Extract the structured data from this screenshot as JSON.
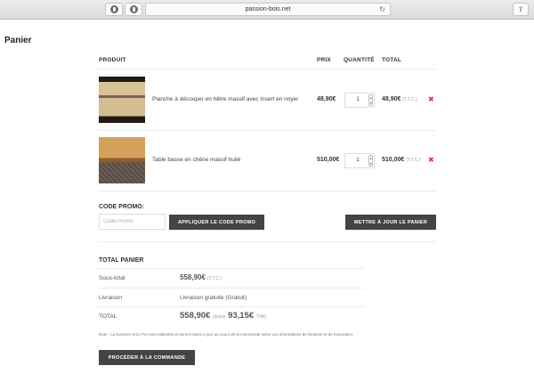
{
  "browser": {
    "address": "passion-bois.net",
    "reload_glyph": "↻",
    "share_glyph": "⇪"
  },
  "page": {
    "title": "Panier"
  },
  "table": {
    "headers": {
      "product": "PRODUIT",
      "price": "PRIX",
      "quantity": "QUANTITÉ",
      "total": "TOTAL"
    },
    "rows": [
      {
        "name": "Planche à découper en hêtre massif avec insert en noyer",
        "price": "48,90€",
        "quantity": "1",
        "total": "48,90€",
        "total_suffix": "(T.T.C.)",
        "remove": "✖"
      },
      {
        "name": "Table basse en chêne massif huilé",
        "price": "510,00€",
        "quantity": "1",
        "total": "510,00€",
        "total_suffix": "(T.T.C.)",
        "remove": "✖"
      }
    ]
  },
  "promo": {
    "label": "CODE PROMO:",
    "placeholder": "Code Promo",
    "apply_label": "APPLIQUER LE CODE PROMO",
    "update_label": "METTRE À JOUR LE PANIER"
  },
  "totals": {
    "title": "TOTAL PANIER",
    "subtotal_label": "Sous-total",
    "subtotal_value": "558,90€",
    "subtotal_suffix": "(T.T.C.)",
    "shipping_label": "Livraison",
    "shipping_value": "Livraison gratuite (Gratuit)",
    "total_label": "TOTAL",
    "total_value": "558,90€",
    "total_incl": "(inclus",
    "tax_value": "93,15€",
    "tax_suffix": "TVA)",
    "note": "Note : La livraison et la TVA sont estimées et seront mises à jour au cours de la commande selon vos informations de livraison et de facturation.",
    "checkout_label": "PROCÉDER À LA COMMANDE"
  },
  "colors": {
    "button_dark": "#444444",
    "remove_red": "#e0322a"
  }
}
